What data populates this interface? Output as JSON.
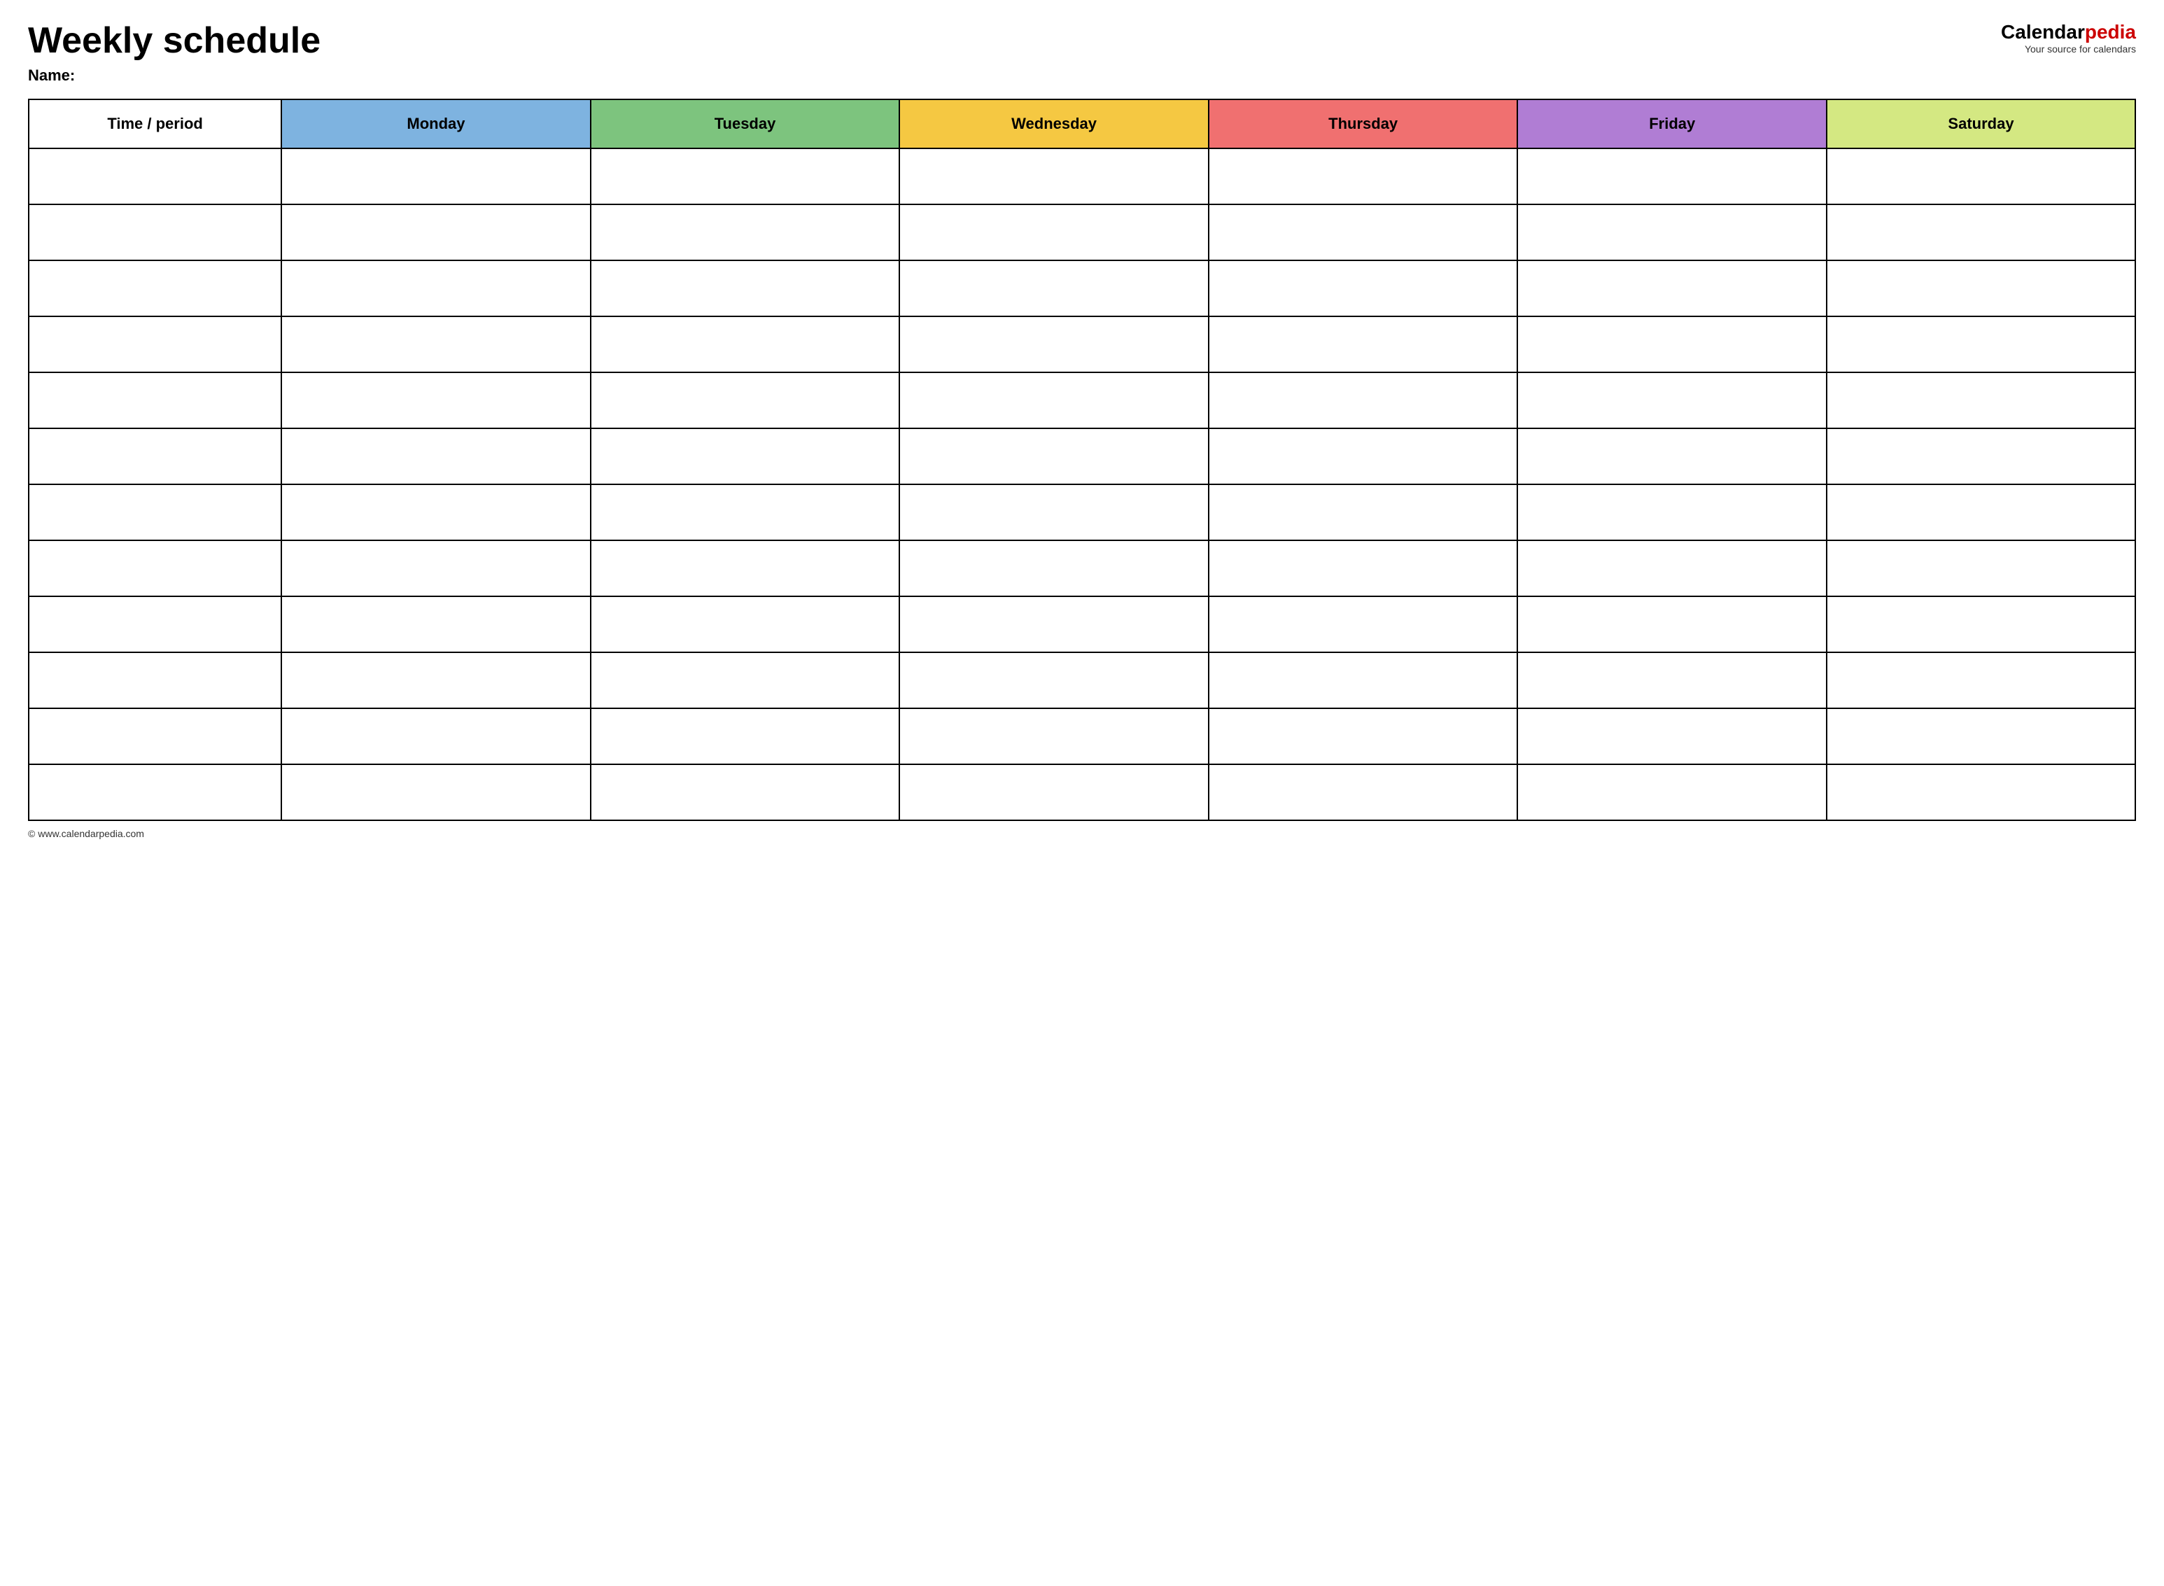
{
  "header": {
    "title": "Weekly schedule",
    "name_label": "Name:",
    "logo_text_black": "Calendar",
    "logo_text_red": "pedia",
    "logo_tagline": "Your source for calendars"
  },
  "table": {
    "columns": [
      {
        "id": "time",
        "label": "Time / period",
        "color": "#ffffff"
      },
      {
        "id": "monday",
        "label": "Monday",
        "color": "#7eb3e0"
      },
      {
        "id": "tuesday",
        "label": "Tuesday",
        "color": "#7dc47e"
      },
      {
        "id": "wednesday",
        "label": "Wednesday",
        "color": "#f5c842"
      },
      {
        "id": "thursday",
        "label": "Thursday",
        "color": "#f07070"
      },
      {
        "id": "friday",
        "label": "Friday",
        "color": "#b07dd4"
      },
      {
        "id": "saturday",
        "label": "Saturday",
        "color": "#d4e882"
      }
    ],
    "row_count": 12
  },
  "footer": {
    "url": "www.calendarpedia.com"
  }
}
